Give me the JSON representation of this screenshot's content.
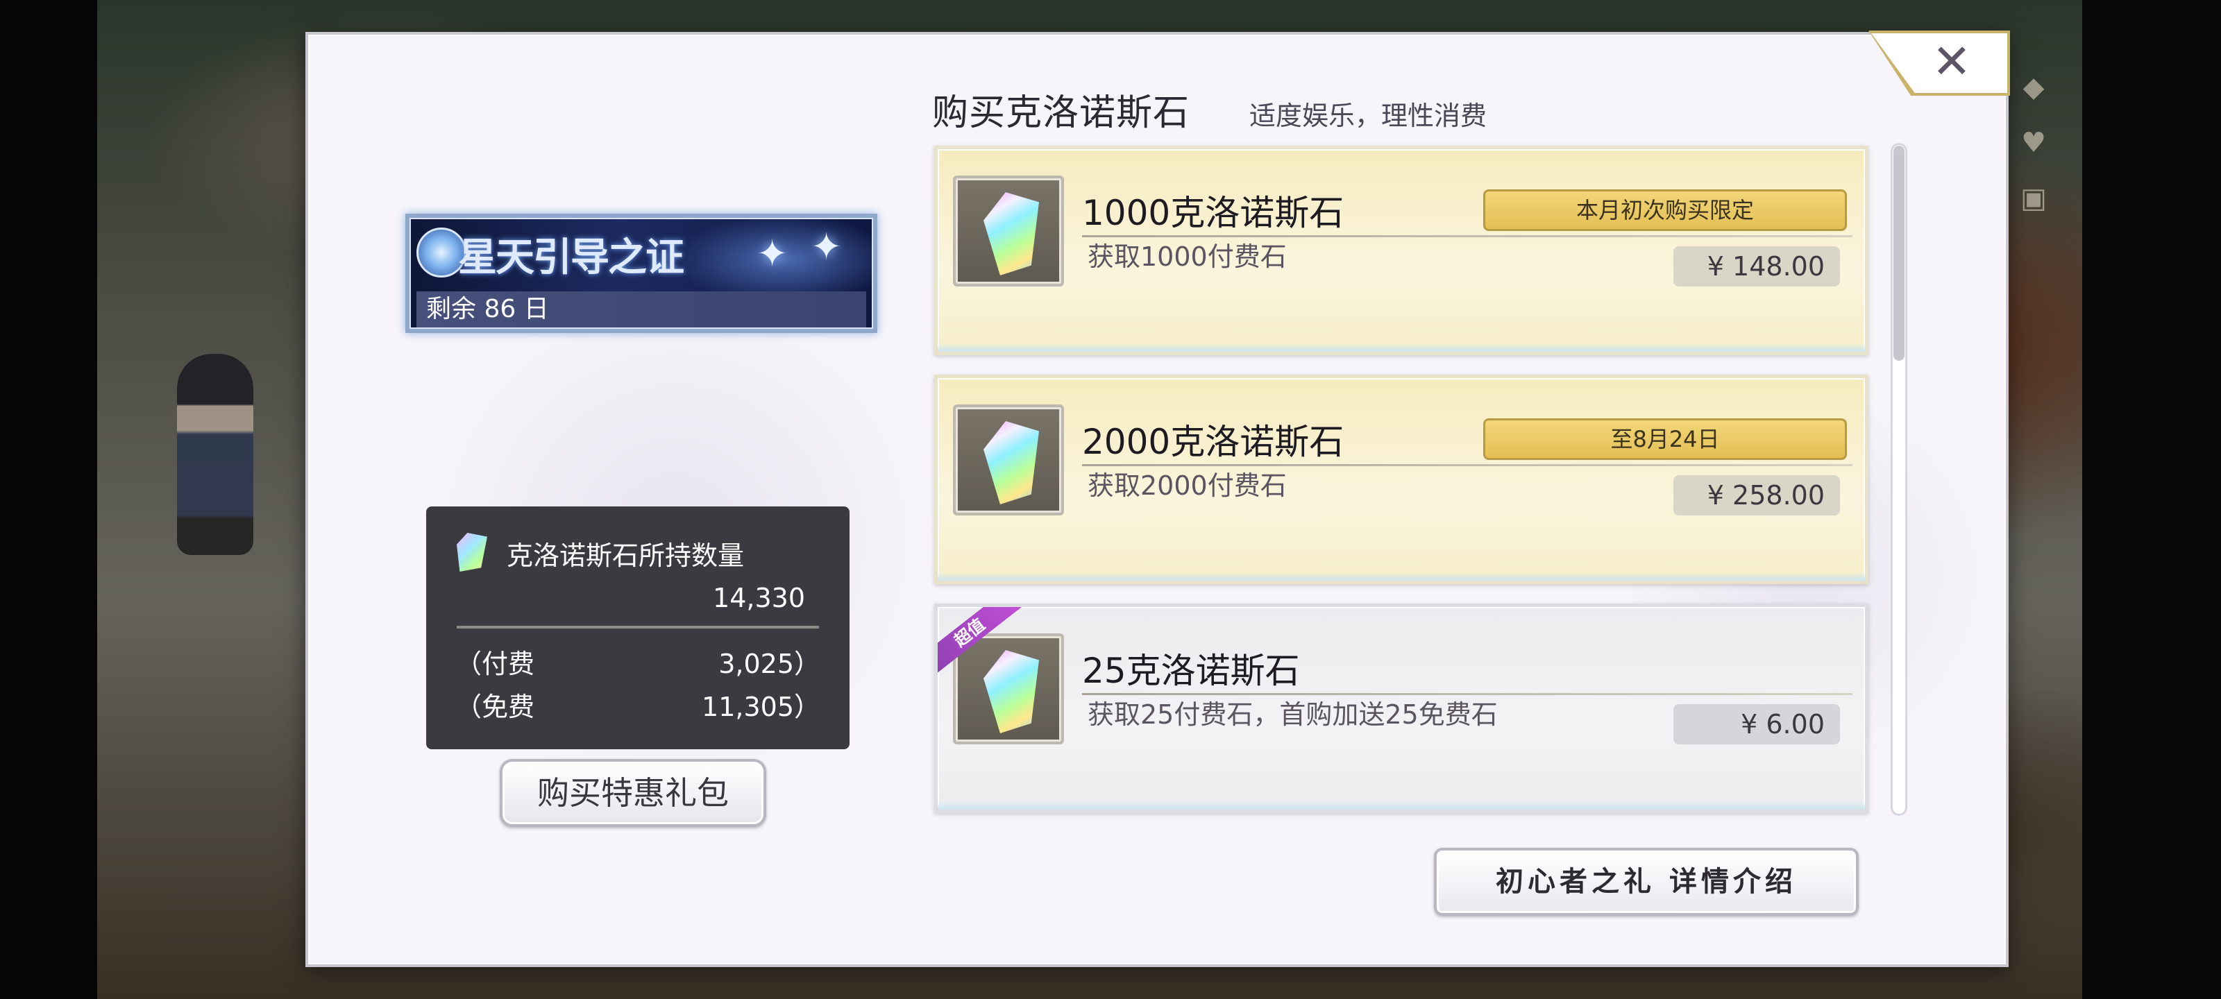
{
  "header": {
    "title": "购买克洛诺斯石",
    "subtitle": "适度娱乐，理性消费",
    "close_icon": "close-icon",
    "close_glyph": "✕"
  },
  "pass": {
    "logo_text": "星天引导之证",
    "remaining": "剩余 86 日"
  },
  "balance": {
    "label": "克洛诺斯石所持数量",
    "total": "14,330",
    "rows": [
      {
        "label": "（付费",
        "value": "3,025）"
      },
      {
        "label": "（免费",
        "value": "11,305）"
      }
    ]
  },
  "gift_button_label": "购买特惠礼包",
  "products": [
    {
      "name": "1000克洛诺斯石",
      "desc": "获取1000付费石",
      "limit": "本月初次购买限定",
      "price": "¥ 148.00"
    },
    {
      "name": "2000克洛诺斯石",
      "desc": "获取2000付费石",
      "limit": "至8月24日",
      "price": "¥ 258.00"
    },
    {
      "name": "25克洛诺斯石",
      "desc": "获取25付费石，首购加送25免费石",
      "badge": "超值",
      "price": "¥ 6.00"
    }
  ],
  "beginner_button_label": "初心者之礼 详情介绍",
  "colors": {
    "card_gold": "#f6ebbe",
    "limit_tag": "#e4bf55",
    "badge_purple": "#8b3fb0",
    "balance_panel": "#3b3a40"
  }
}
